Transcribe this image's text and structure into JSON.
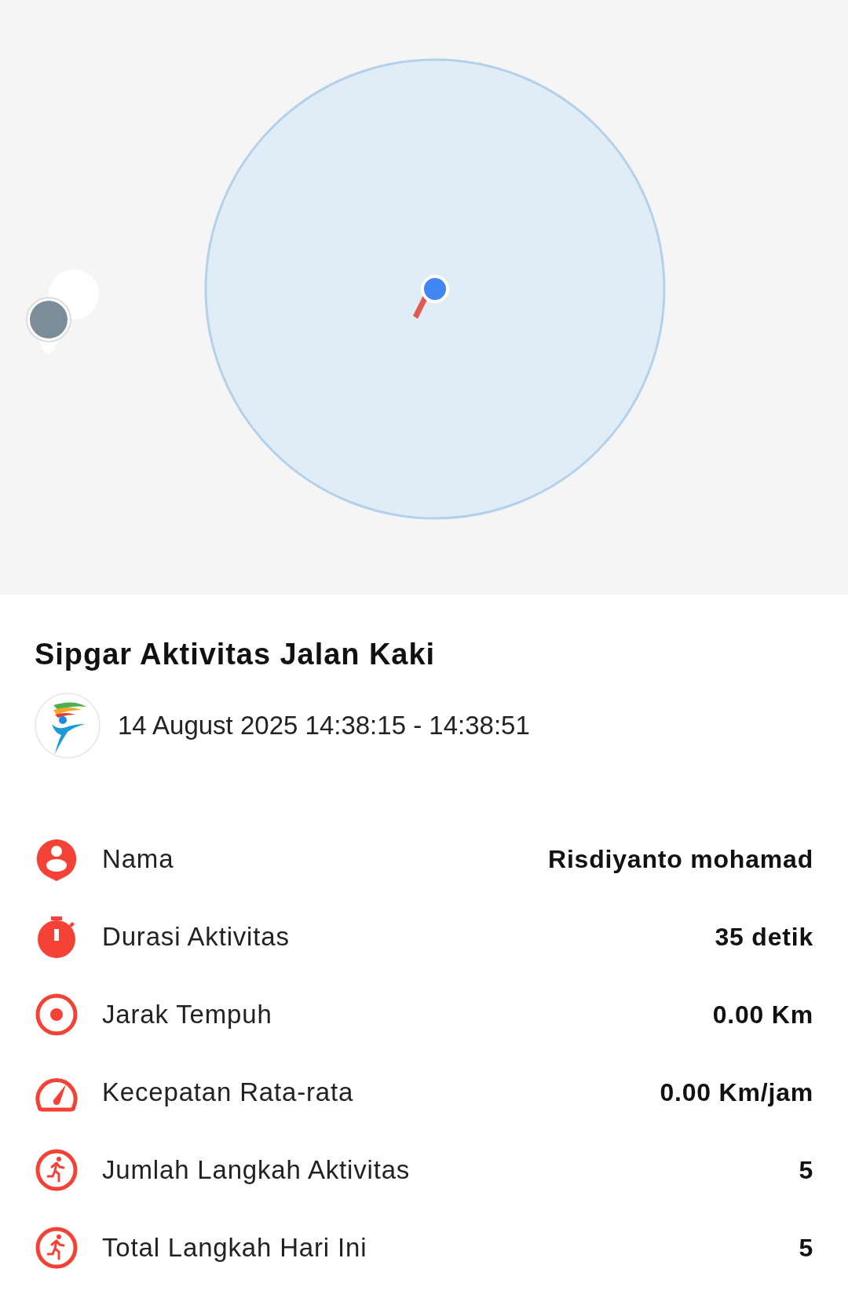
{
  "activity": {
    "title": "Sipgar Aktivitas Jalan Kaki",
    "time_range": "14 August 2025 14:38:15 - 14:38:51"
  },
  "stats": [
    {
      "kind": "person",
      "label": "Nama",
      "value": "Risdiyanto mohamad"
    },
    {
      "kind": "stopwatch",
      "label": "Durasi Aktivitas",
      "value": "35 detik"
    },
    {
      "kind": "target",
      "label": "Jarak Tempuh",
      "value": "0.00 Km"
    },
    {
      "kind": "gauge",
      "label": "Kecepatan Rata-rata",
      "value": "0.00 Km/jam"
    },
    {
      "kind": "runner",
      "label": "Jumlah Langkah Aktivitas",
      "value": "5"
    },
    {
      "kind": "runner",
      "label": "Total Langkah Hari Ini",
      "value": "5"
    }
  ]
}
